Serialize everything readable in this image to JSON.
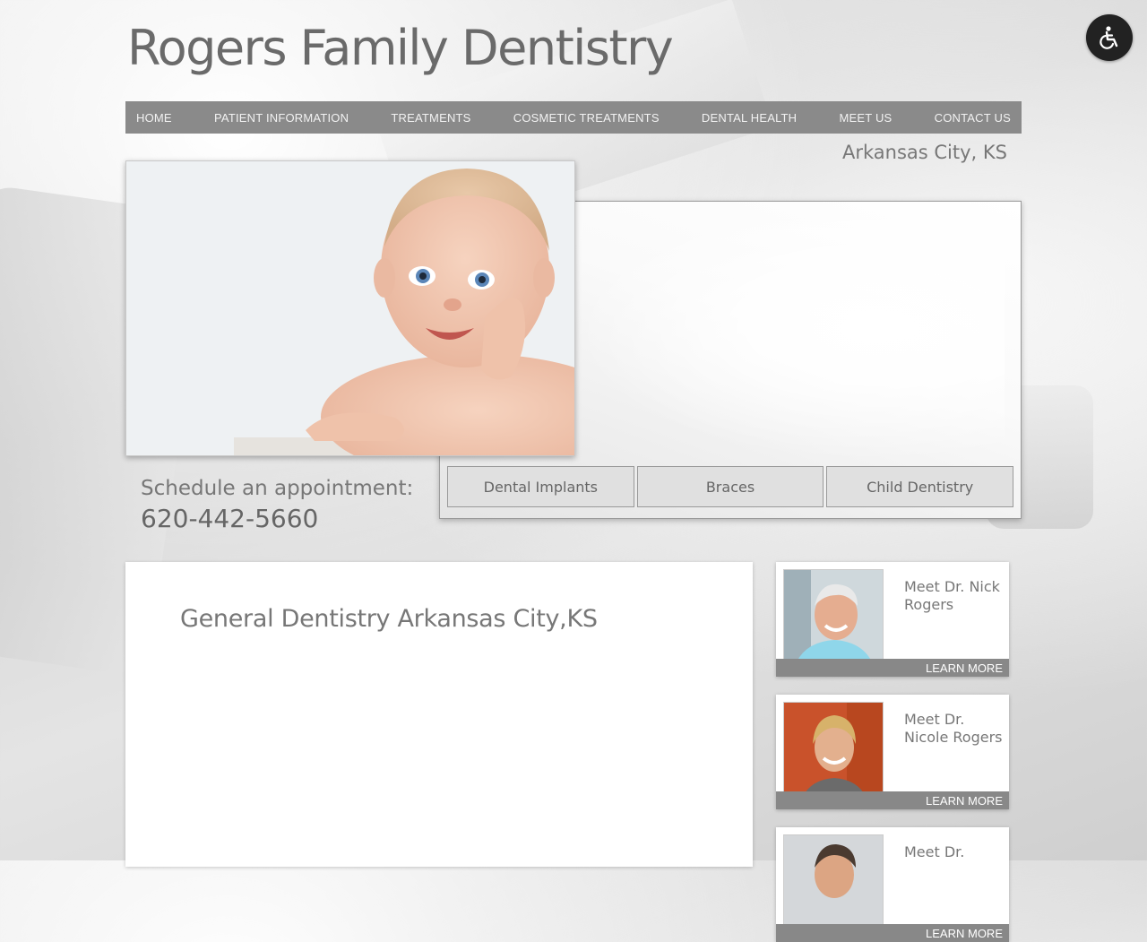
{
  "site": {
    "title": "Rogers Family Dentistry",
    "location": "Arkansas City, KS"
  },
  "nav": {
    "items": [
      {
        "label": "HOME"
      },
      {
        "label": "PATIENT INFORMATION"
      },
      {
        "label": "TREATMENTS"
      },
      {
        "label": "COSMETIC TREATMENTS"
      },
      {
        "label": "DENTAL HEALTH"
      },
      {
        "label": "MEET US"
      },
      {
        "label": "CONTACT US"
      }
    ]
  },
  "accessibility": {
    "icon": "wheelchair-icon"
  },
  "hero": {
    "image": "baby-smiling-photo",
    "services": [
      {
        "label": "Dental Implants"
      },
      {
        "label": "Braces"
      },
      {
        "label": "Child Dentistry"
      }
    ]
  },
  "appointment": {
    "label": "Schedule an appointment:",
    "phone": "620-442-5660"
  },
  "main": {
    "heading": "General Dentistry Arkansas City,KS"
  },
  "doctors": [
    {
      "name": "Meet Dr. Nick Rogers",
      "learn_more": "LEARN MORE"
    },
    {
      "name": "Meet Dr. Nicole Rogers",
      "learn_more": "LEARN MORE"
    },
    {
      "name": "Meet Dr.",
      "learn_more": "LEARN MORE"
    }
  ],
  "colors": {
    "nav_bg": "#8a8a8a",
    "learn_bar": "#888888",
    "access_btn": "#222222"
  }
}
